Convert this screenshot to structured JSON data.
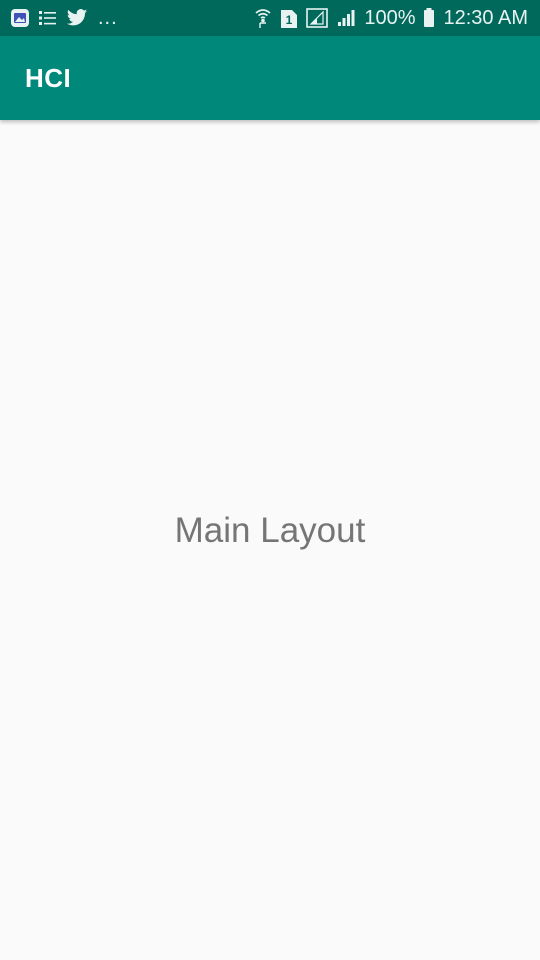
{
  "status_bar": {
    "notifications": [
      "gallery-icon",
      "list-icon",
      "twitter-icon"
    ],
    "more": "...",
    "battery": "100%",
    "time": "12:30 AM",
    "sim_label": "1",
    "colors": {
      "background": "#00695c",
      "text": "#e8f3f1"
    }
  },
  "app_bar": {
    "title": "HCI",
    "color": "#00897b"
  },
  "main": {
    "text": "Main Layout",
    "text_color": "#757575",
    "background": "#fafafa"
  }
}
